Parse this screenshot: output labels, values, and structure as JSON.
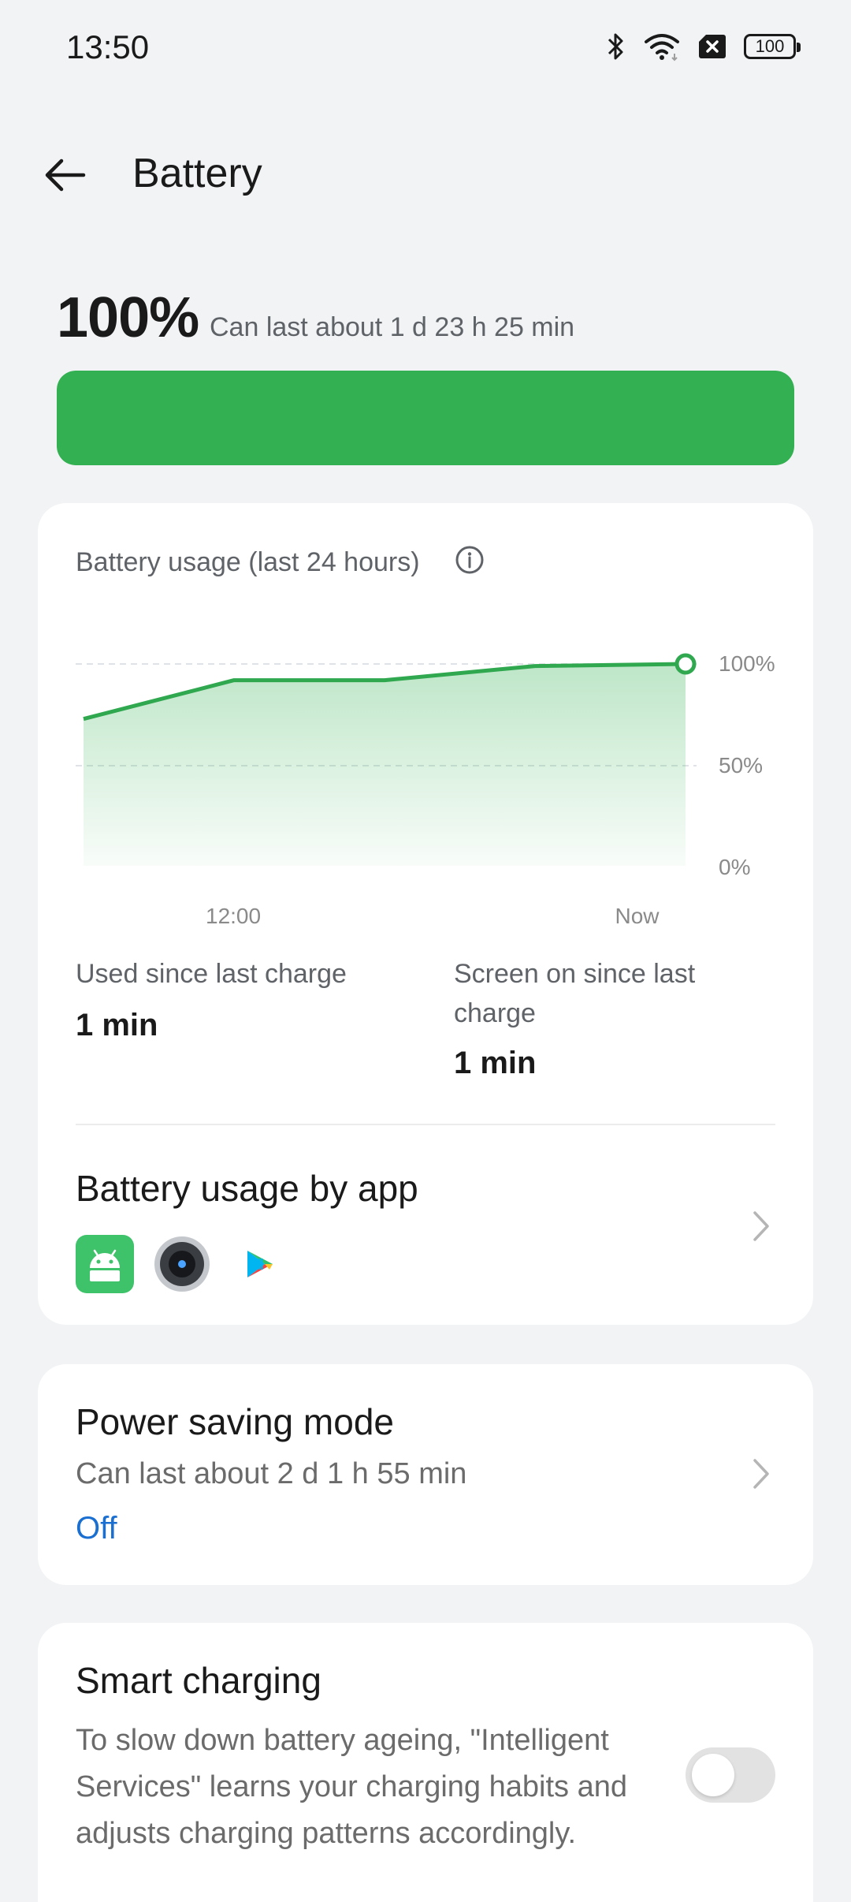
{
  "status_bar": {
    "time": "13:50",
    "battery_level": "100",
    "icons": [
      "bluetooth-icon",
      "wifi-icon",
      "sim-off-icon",
      "battery-icon"
    ]
  },
  "header": {
    "title": "Battery",
    "back_icon": "arrow-left-icon"
  },
  "summary": {
    "percent": "100%",
    "estimate": "Can last about 1 d 23 h 25 min",
    "level_fraction": 1.0,
    "level_color": "#33b152"
  },
  "usage_card": {
    "title": "Battery usage (last 24 hours)",
    "info_icon": "info-icon",
    "used_since_charge_label": "Used since last charge",
    "used_since_charge_value": "1 min",
    "screen_on_label": "Screen on since last charge",
    "screen_on_value": "1 min",
    "by_app_title": "Battery usage by app",
    "app_icons": [
      "android-system-icon",
      "camera-icon",
      "play-services-icon"
    ]
  },
  "chart_data": {
    "type": "area",
    "title": "",
    "x": [
      0,
      0.25,
      0.5,
      0.75,
      1.0
    ],
    "values": [
      73,
      92,
      92,
      99,
      100
    ],
    "x_tick_labels": [
      {
        "label": "12:00",
        "pos": 0.25
      },
      {
        "label": "Now",
        "pos": 0.93
      }
    ],
    "y_tick_labels": [
      "100%",
      "50%",
      "0%"
    ],
    "ylim": [
      0,
      100
    ],
    "grid": true,
    "line_color": "#2fa84f"
  },
  "power_saving": {
    "title": "Power saving mode",
    "estimate": "Can last about 2 d 1 h 55 min",
    "status": "Off"
  },
  "smart_charging": {
    "title": "Smart charging",
    "description": "To slow down battery ageing, \"Intelligent Services\" learns your charging habits and adjusts charging patterns accordingly.",
    "enabled": false
  }
}
